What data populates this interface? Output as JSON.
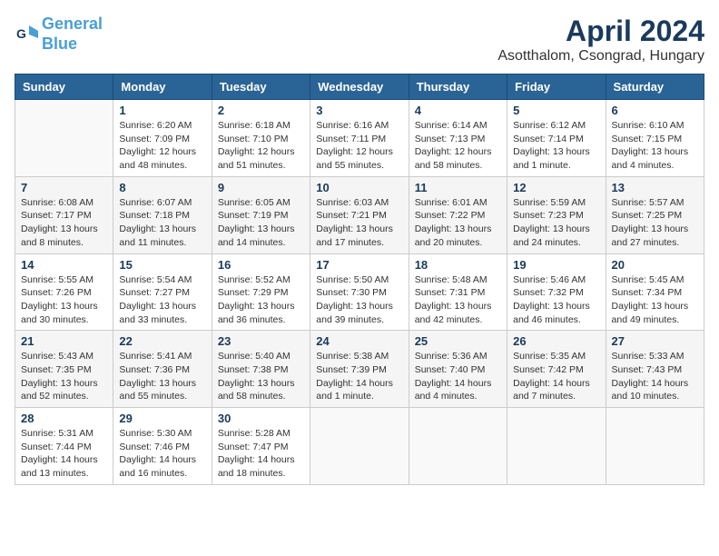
{
  "header": {
    "logo_line1": "General",
    "logo_line2": "Blue",
    "title": "April 2024",
    "subtitle": "Asotthalom, Csongrad, Hungary"
  },
  "calendar": {
    "weekdays": [
      "Sunday",
      "Monday",
      "Tuesday",
      "Wednesday",
      "Thursday",
      "Friday",
      "Saturday"
    ],
    "weeks": [
      [
        {
          "day": "",
          "detail": ""
        },
        {
          "day": "1",
          "detail": "Sunrise: 6:20 AM\nSunset: 7:09 PM\nDaylight: 12 hours\nand 48 minutes."
        },
        {
          "day": "2",
          "detail": "Sunrise: 6:18 AM\nSunset: 7:10 PM\nDaylight: 12 hours\nand 51 minutes."
        },
        {
          "day": "3",
          "detail": "Sunrise: 6:16 AM\nSunset: 7:11 PM\nDaylight: 12 hours\nand 55 minutes."
        },
        {
          "day": "4",
          "detail": "Sunrise: 6:14 AM\nSunset: 7:13 PM\nDaylight: 12 hours\nand 58 minutes."
        },
        {
          "day": "5",
          "detail": "Sunrise: 6:12 AM\nSunset: 7:14 PM\nDaylight: 13 hours\nand 1 minute."
        },
        {
          "day": "6",
          "detail": "Sunrise: 6:10 AM\nSunset: 7:15 PM\nDaylight: 13 hours\nand 4 minutes."
        }
      ],
      [
        {
          "day": "7",
          "detail": "Sunrise: 6:08 AM\nSunset: 7:17 PM\nDaylight: 13 hours\nand 8 minutes."
        },
        {
          "day": "8",
          "detail": "Sunrise: 6:07 AM\nSunset: 7:18 PM\nDaylight: 13 hours\nand 11 minutes."
        },
        {
          "day": "9",
          "detail": "Sunrise: 6:05 AM\nSunset: 7:19 PM\nDaylight: 13 hours\nand 14 minutes."
        },
        {
          "day": "10",
          "detail": "Sunrise: 6:03 AM\nSunset: 7:21 PM\nDaylight: 13 hours\nand 17 minutes."
        },
        {
          "day": "11",
          "detail": "Sunrise: 6:01 AM\nSunset: 7:22 PM\nDaylight: 13 hours\nand 20 minutes."
        },
        {
          "day": "12",
          "detail": "Sunrise: 5:59 AM\nSunset: 7:23 PM\nDaylight: 13 hours\nand 24 minutes."
        },
        {
          "day": "13",
          "detail": "Sunrise: 5:57 AM\nSunset: 7:25 PM\nDaylight: 13 hours\nand 27 minutes."
        }
      ],
      [
        {
          "day": "14",
          "detail": "Sunrise: 5:55 AM\nSunset: 7:26 PM\nDaylight: 13 hours\nand 30 minutes."
        },
        {
          "day": "15",
          "detail": "Sunrise: 5:54 AM\nSunset: 7:27 PM\nDaylight: 13 hours\nand 33 minutes."
        },
        {
          "day": "16",
          "detail": "Sunrise: 5:52 AM\nSunset: 7:29 PM\nDaylight: 13 hours\nand 36 minutes."
        },
        {
          "day": "17",
          "detail": "Sunrise: 5:50 AM\nSunset: 7:30 PM\nDaylight: 13 hours\nand 39 minutes."
        },
        {
          "day": "18",
          "detail": "Sunrise: 5:48 AM\nSunset: 7:31 PM\nDaylight: 13 hours\nand 42 minutes."
        },
        {
          "day": "19",
          "detail": "Sunrise: 5:46 AM\nSunset: 7:32 PM\nDaylight: 13 hours\nand 46 minutes."
        },
        {
          "day": "20",
          "detail": "Sunrise: 5:45 AM\nSunset: 7:34 PM\nDaylight: 13 hours\nand 49 minutes."
        }
      ],
      [
        {
          "day": "21",
          "detail": "Sunrise: 5:43 AM\nSunset: 7:35 PM\nDaylight: 13 hours\nand 52 minutes."
        },
        {
          "day": "22",
          "detail": "Sunrise: 5:41 AM\nSunset: 7:36 PM\nDaylight: 13 hours\nand 55 minutes."
        },
        {
          "day": "23",
          "detail": "Sunrise: 5:40 AM\nSunset: 7:38 PM\nDaylight: 13 hours\nand 58 minutes."
        },
        {
          "day": "24",
          "detail": "Sunrise: 5:38 AM\nSunset: 7:39 PM\nDaylight: 14 hours\nand 1 minute."
        },
        {
          "day": "25",
          "detail": "Sunrise: 5:36 AM\nSunset: 7:40 PM\nDaylight: 14 hours\nand 4 minutes."
        },
        {
          "day": "26",
          "detail": "Sunrise: 5:35 AM\nSunset: 7:42 PM\nDaylight: 14 hours\nand 7 minutes."
        },
        {
          "day": "27",
          "detail": "Sunrise: 5:33 AM\nSunset: 7:43 PM\nDaylight: 14 hours\nand 10 minutes."
        }
      ],
      [
        {
          "day": "28",
          "detail": "Sunrise: 5:31 AM\nSunset: 7:44 PM\nDaylight: 14 hours\nand 13 minutes."
        },
        {
          "day": "29",
          "detail": "Sunrise: 5:30 AM\nSunset: 7:46 PM\nDaylight: 14 hours\nand 16 minutes."
        },
        {
          "day": "30",
          "detail": "Sunrise: 5:28 AM\nSunset: 7:47 PM\nDaylight: 14 hours\nand 18 minutes."
        },
        {
          "day": "",
          "detail": ""
        },
        {
          "day": "",
          "detail": ""
        },
        {
          "day": "",
          "detail": ""
        },
        {
          "day": "",
          "detail": ""
        }
      ]
    ]
  }
}
